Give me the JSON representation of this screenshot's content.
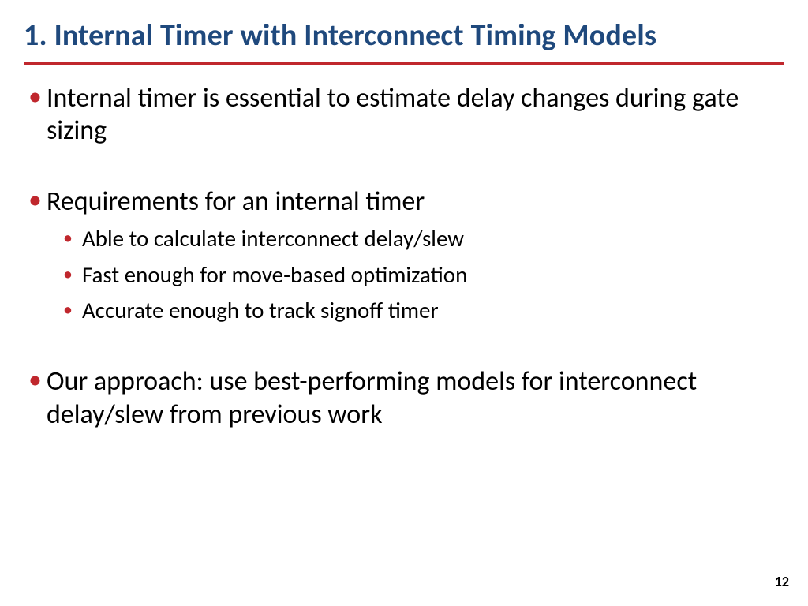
{
  "title": "1. Internal Timer with Interconnect Timing Models",
  "bullets": {
    "b1": "Internal timer is essential to estimate delay changes during gate sizing",
    "b2": "Requirements for an internal timer",
    "b2a": "Able to calculate interconnect delay/slew",
    "b2b": "Fast enough for move-based optimization",
    "b2c": "Accurate enough to track signoff timer",
    "b3": "Our approach: use best-performing models for interconnect delay/slew from previous work"
  },
  "page_number": "12"
}
